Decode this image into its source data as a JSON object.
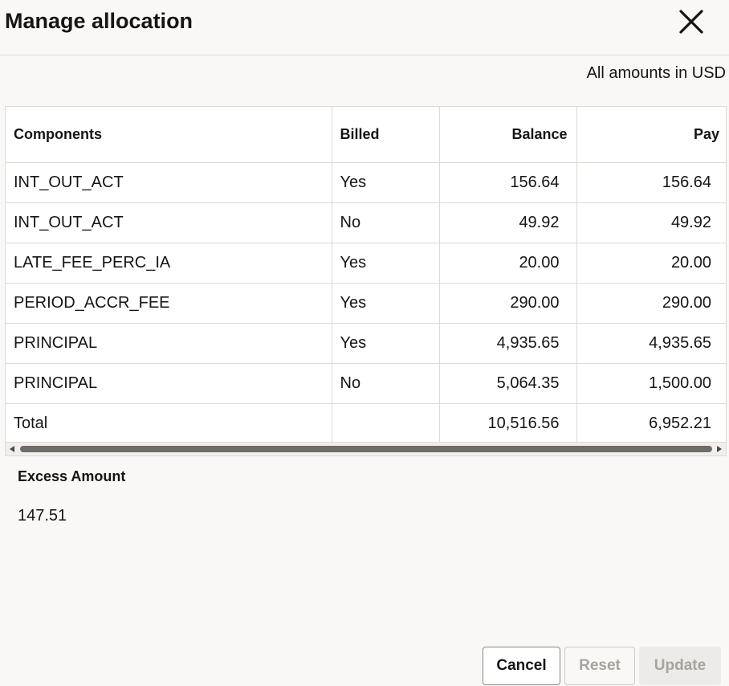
{
  "dialog": {
    "title": "Manage allocation",
    "close_icon": "close-icon",
    "currency_note": "All amounts in USD"
  },
  "table": {
    "columns": [
      "Components",
      "Billed",
      "Balance",
      "Pay"
    ],
    "rows": [
      {
        "component": "INT_OUT_ACT",
        "billed": "Yes",
        "balance": "156.64",
        "pay": "156.64"
      },
      {
        "component": "INT_OUT_ACT",
        "billed": "No",
        "balance": "49.92",
        "pay": "49.92"
      },
      {
        "component": "LATE_FEE_PERC_IA",
        "billed": "Yes",
        "balance": "20.00",
        "pay": "20.00"
      },
      {
        "component": "PERIOD_ACCR_FEE",
        "billed": "Yes",
        "balance": "290.00",
        "pay": "290.00"
      },
      {
        "component": "PRINCIPAL",
        "billed": "Yes",
        "balance": "4,935.65",
        "pay": "4,935.65"
      },
      {
        "component": "PRINCIPAL",
        "billed": "No",
        "balance": "5,064.35",
        "pay": "1,500.00"
      }
    ],
    "total": {
      "label": "Total",
      "billed": "",
      "balance": "10,516.56",
      "pay": "6,952.21"
    }
  },
  "excess": {
    "label": "Excess Amount",
    "value": "147.51"
  },
  "buttons": {
    "cancel": "Cancel",
    "reset": "Reset",
    "update": "Update"
  }
}
